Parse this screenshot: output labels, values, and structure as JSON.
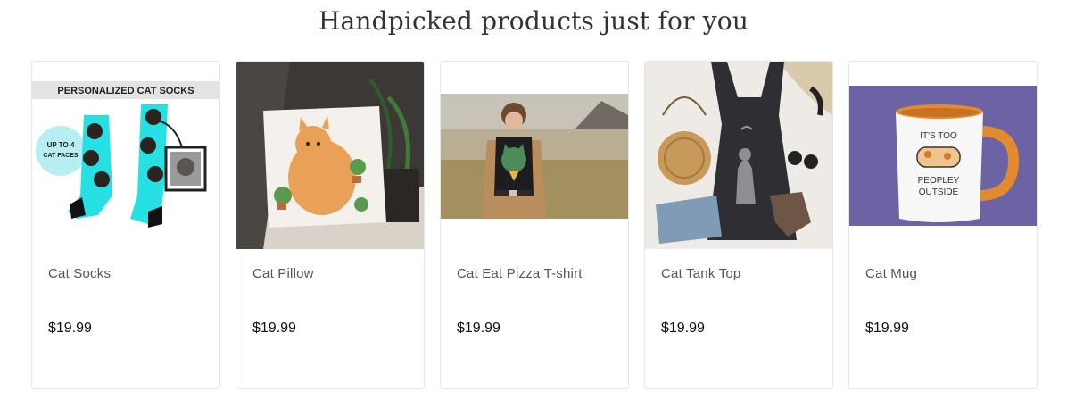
{
  "section": {
    "title": "Handpicked products just for you"
  },
  "products": [
    {
      "name": "Cat Socks",
      "price": "$19.99",
      "image_banner": "PERSONALIZED CAT SOCKS",
      "image_badge": "UP TO 4 CAT FACES",
      "image": "cat-socks-image"
    },
    {
      "name": "Cat Pillow",
      "price": "$19.99",
      "image": "cat-pillow-image"
    },
    {
      "name": "Cat Eat Pizza T-shirt",
      "price": "$19.99",
      "image": "cat-pizza-tshirt-image"
    },
    {
      "name": "Cat Tank Top",
      "price": "$19.99",
      "image": "cat-tank-top-image"
    },
    {
      "name": "Cat Mug",
      "price": "$19.99",
      "image_text_1": "IT'S TOO",
      "image_text_2": "PEOPLEY",
      "image_text_3": "OUTSIDE",
      "image": "cat-mug-image"
    }
  ]
}
